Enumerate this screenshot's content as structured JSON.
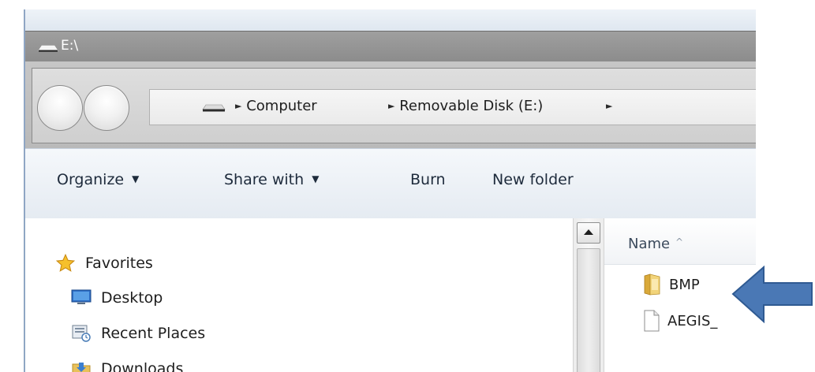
{
  "window": {
    "title": "E:\\"
  },
  "address": {
    "breadcrumbs": [
      {
        "label": "Computer"
      },
      {
        "label": "Removable Disk (E:)"
      }
    ]
  },
  "toolbar": {
    "organize": "Organize",
    "share_with": "Share with",
    "burn": "Burn",
    "new_folder": "New folder"
  },
  "nav_pane": {
    "items": [
      {
        "label": "Favorites",
        "icon": "star-icon"
      },
      {
        "label": "Desktop",
        "icon": "desktop-icon"
      },
      {
        "label": "Recent Places",
        "icon": "recent-places-icon"
      },
      {
        "label": "Downloads",
        "icon": "downloads-folder-icon"
      }
    ]
  },
  "file_list": {
    "column_name": "Name",
    "items": [
      {
        "label": "BMP",
        "icon": "folder-icon"
      },
      {
        "label": "AEGIS_",
        "icon": "file-icon"
      }
    ]
  },
  "colors": {
    "callout_arrow_fill": "#4a78b5",
    "callout_arrow_stroke": "#2f5a92"
  }
}
